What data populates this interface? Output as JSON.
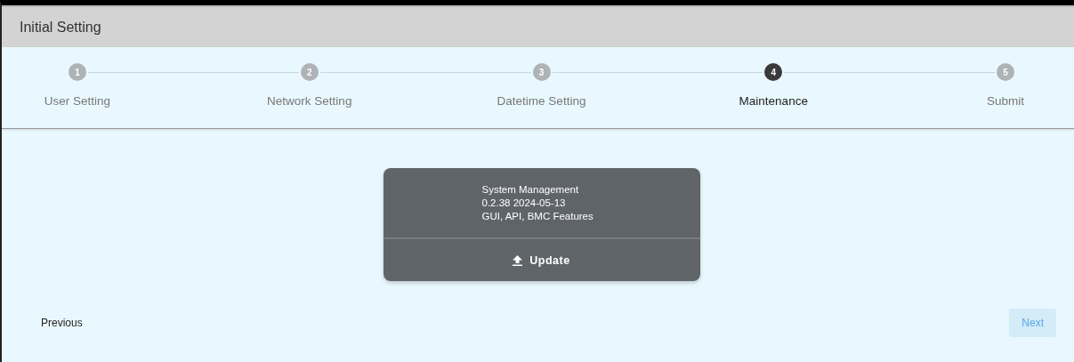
{
  "window": {
    "title": "Initial Setting"
  },
  "steps": [
    {
      "number": "1",
      "label": "User Setting",
      "selected": false
    },
    {
      "number": "2",
      "label": "Network Setting",
      "selected": false
    },
    {
      "number": "3",
      "label": "Datetime Setting",
      "selected": false
    },
    {
      "number": "4",
      "label": "Maintenance",
      "selected": true
    },
    {
      "number": "5",
      "label": "Submit",
      "selected": false
    }
  ],
  "card": {
    "lines": [
      "System Management",
      "0.2.38 2024-05-13",
      "GUI, API, BMC Features"
    ],
    "button": "Update"
  },
  "footer": {
    "previous": {
      "label": "Previous",
      "disabled": false
    },
    "next": {
      "label": "Next",
      "disabled": true
    }
  }
}
